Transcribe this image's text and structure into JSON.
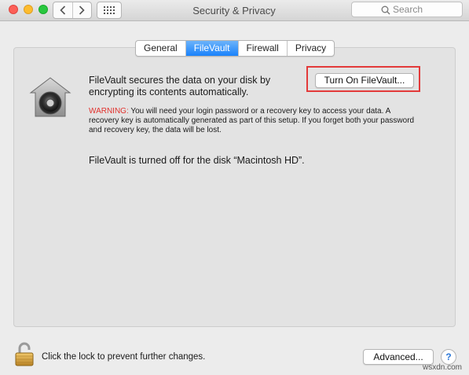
{
  "window": {
    "title": "Security & Privacy"
  },
  "toolbar": {
    "search_placeholder": "Search"
  },
  "tabs": [
    {
      "label": "General",
      "active": false
    },
    {
      "label": "FileVault",
      "active": true
    },
    {
      "label": "Firewall",
      "active": false
    },
    {
      "label": "Privacy",
      "active": false
    }
  ],
  "filevault": {
    "description": "FileVault secures the data on your disk by encrypting its contents automatically.",
    "turn_on_label": "Turn On FileVault...",
    "warning_label": "WARNING:",
    "warning_text": " You will need your login password or a recovery key to access your data. A recovery key is automatically generated as part of this setup. If you forget both your password and recovery key, the data will be lost.",
    "status": "FileVault is turned off for the disk “Macintosh HD”."
  },
  "footer": {
    "lock_text": "Click the lock to prevent further changes.",
    "advanced_label": "Advanced...",
    "help_label": "?"
  },
  "watermark": "wsxdn.com",
  "colors": {
    "accent": "#1a82fb",
    "warning": "#e1322d",
    "highlight_border": "#e33a3a"
  },
  "icons": [
    "back-icon",
    "forward-icon",
    "grid-icon",
    "search-icon",
    "filevault-icon",
    "lock-icon"
  ]
}
